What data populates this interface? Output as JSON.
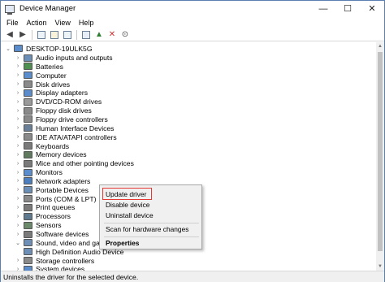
{
  "window": {
    "title": "Device Manager",
    "controls": {
      "minimize": "—",
      "maximize": "☐",
      "close": "✕"
    }
  },
  "menubar": [
    "File",
    "Action",
    "View",
    "Help"
  ],
  "toolbar": {
    "buttons": [
      "back-icon",
      "forward-icon",
      "device-view-icon",
      "help-icon",
      "properties-icon",
      "scan-icon",
      "update-driver-icon",
      "uninstall-icon",
      "download-icon"
    ]
  },
  "tree": {
    "root": "DESKTOP-19ULK5G",
    "nodes": [
      {
        "label": "Audio inputs and outputs",
        "icon": "speaker-icon",
        "color": "#6d8fb5",
        "expanded": false
      },
      {
        "label": "Batteries",
        "icon": "battery-icon",
        "color": "#4f8f4f",
        "expanded": false
      },
      {
        "label": "Computer",
        "icon": "computer-icon",
        "color": "#5b8ccc",
        "expanded": false
      },
      {
        "label": "Disk drives",
        "icon": "disk-icon",
        "color": "#8a8a8a",
        "expanded": false
      },
      {
        "label": "Display adapters",
        "icon": "display-icon",
        "color": "#5b8ccc",
        "expanded": false
      },
      {
        "label": "DVD/CD-ROM drives",
        "icon": "dvd-icon",
        "color": "#9a9a9a",
        "expanded": false
      },
      {
        "label": "Floppy disk drives",
        "icon": "floppy-icon",
        "color": "#8a8a8a",
        "expanded": false
      },
      {
        "label": "Floppy drive controllers",
        "icon": "controller-icon",
        "color": "#8a8a8a",
        "expanded": false
      },
      {
        "label": "Human Interface Devices",
        "icon": "hid-icon",
        "color": "#6a7f98",
        "expanded": false
      },
      {
        "label": "IDE ATA/ATAPI controllers",
        "icon": "ide-icon",
        "color": "#8a8a8a",
        "expanded": false
      },
      {
        "label": "Keyboards",
        "icon": "keyboard-icon",
        "color": "#7a7a7a",
        "expanded": false
      },
      {
        "label": "Memory devices",
        "icon": "memory-icon",
        "color": "#5f7a5f",
        "expanded": false
      },
      {
        "label": "Mice and other pointing devices",
        "icon": "mouse-icon",
        "color": "#7a7a7a",
        "expanded": false
      },
      {
        "label": "Monitors",
        "icon": "monitor-icon",
        "color": "#5b8ccc",
        "expanded": false
      },
      {
        "label": "Network adapters",
        "icon": "network-icon",
        "color": "#4d7fbf",
        "expanded": false
      },
      {
        "label": "Portable Devices",
        "icon": "portable-device-icon",
        "color": "#6d8fb5",
        "expanded": false
      },
      {
        "label": "Ports (COM & LPT)",
        "icon": "port-icon",
        "color": "#8a8a8a",
        "expanded": false
      },
      {
        "label": "Print queues",
        "icon": "printer-icon",
        "color": "#7a7a7a",
        "expanded": false
      },
      {
        "label": "Processors",
        "icon": "processor-icon",
        "color": "#5f7a8f",
        "expanded": false
      },
      {
        "label": "Sensors",
        "icon": "sensor-icon",
        "color": "#6a8a6a",
        "expanded": false
      },
      {
        "label": "Software devices",
        "icon": "software-device-icon",
        "color": "#7a7a7a",
        "expanded": false
      },
      {
        "label": "Sound, video and gar",
        "icon": "sound-icon",
        "color": "#6d8fb5",
        "expanded": true
      },
      {
        "label": "High Definition Audio Device",
        "icon": "speaker-icon",
        "color": "#6d8fb5",
        "child": true
      },
      {
        "label": "Storage controllers",
        "icon": "storage-icon",
        "color": "#8a8a8a",
        "expanded": false
      },
      {
        "label": "System devices",
        "icon": "system-icon",
        "color": "#5b8ccc",
        "expanded": false
      }
    ]
  },
  "context_menu": {
    "items": [
      "Update driver",
      "Disable device",
      "Uninstall device",
      "Scan for hardware changes",
      "Properties"
    ],
    "highlight_color": "#e53935"
  },
  "status": {
    "text": "Uninstalls the driver for the selected device."
  }
}
